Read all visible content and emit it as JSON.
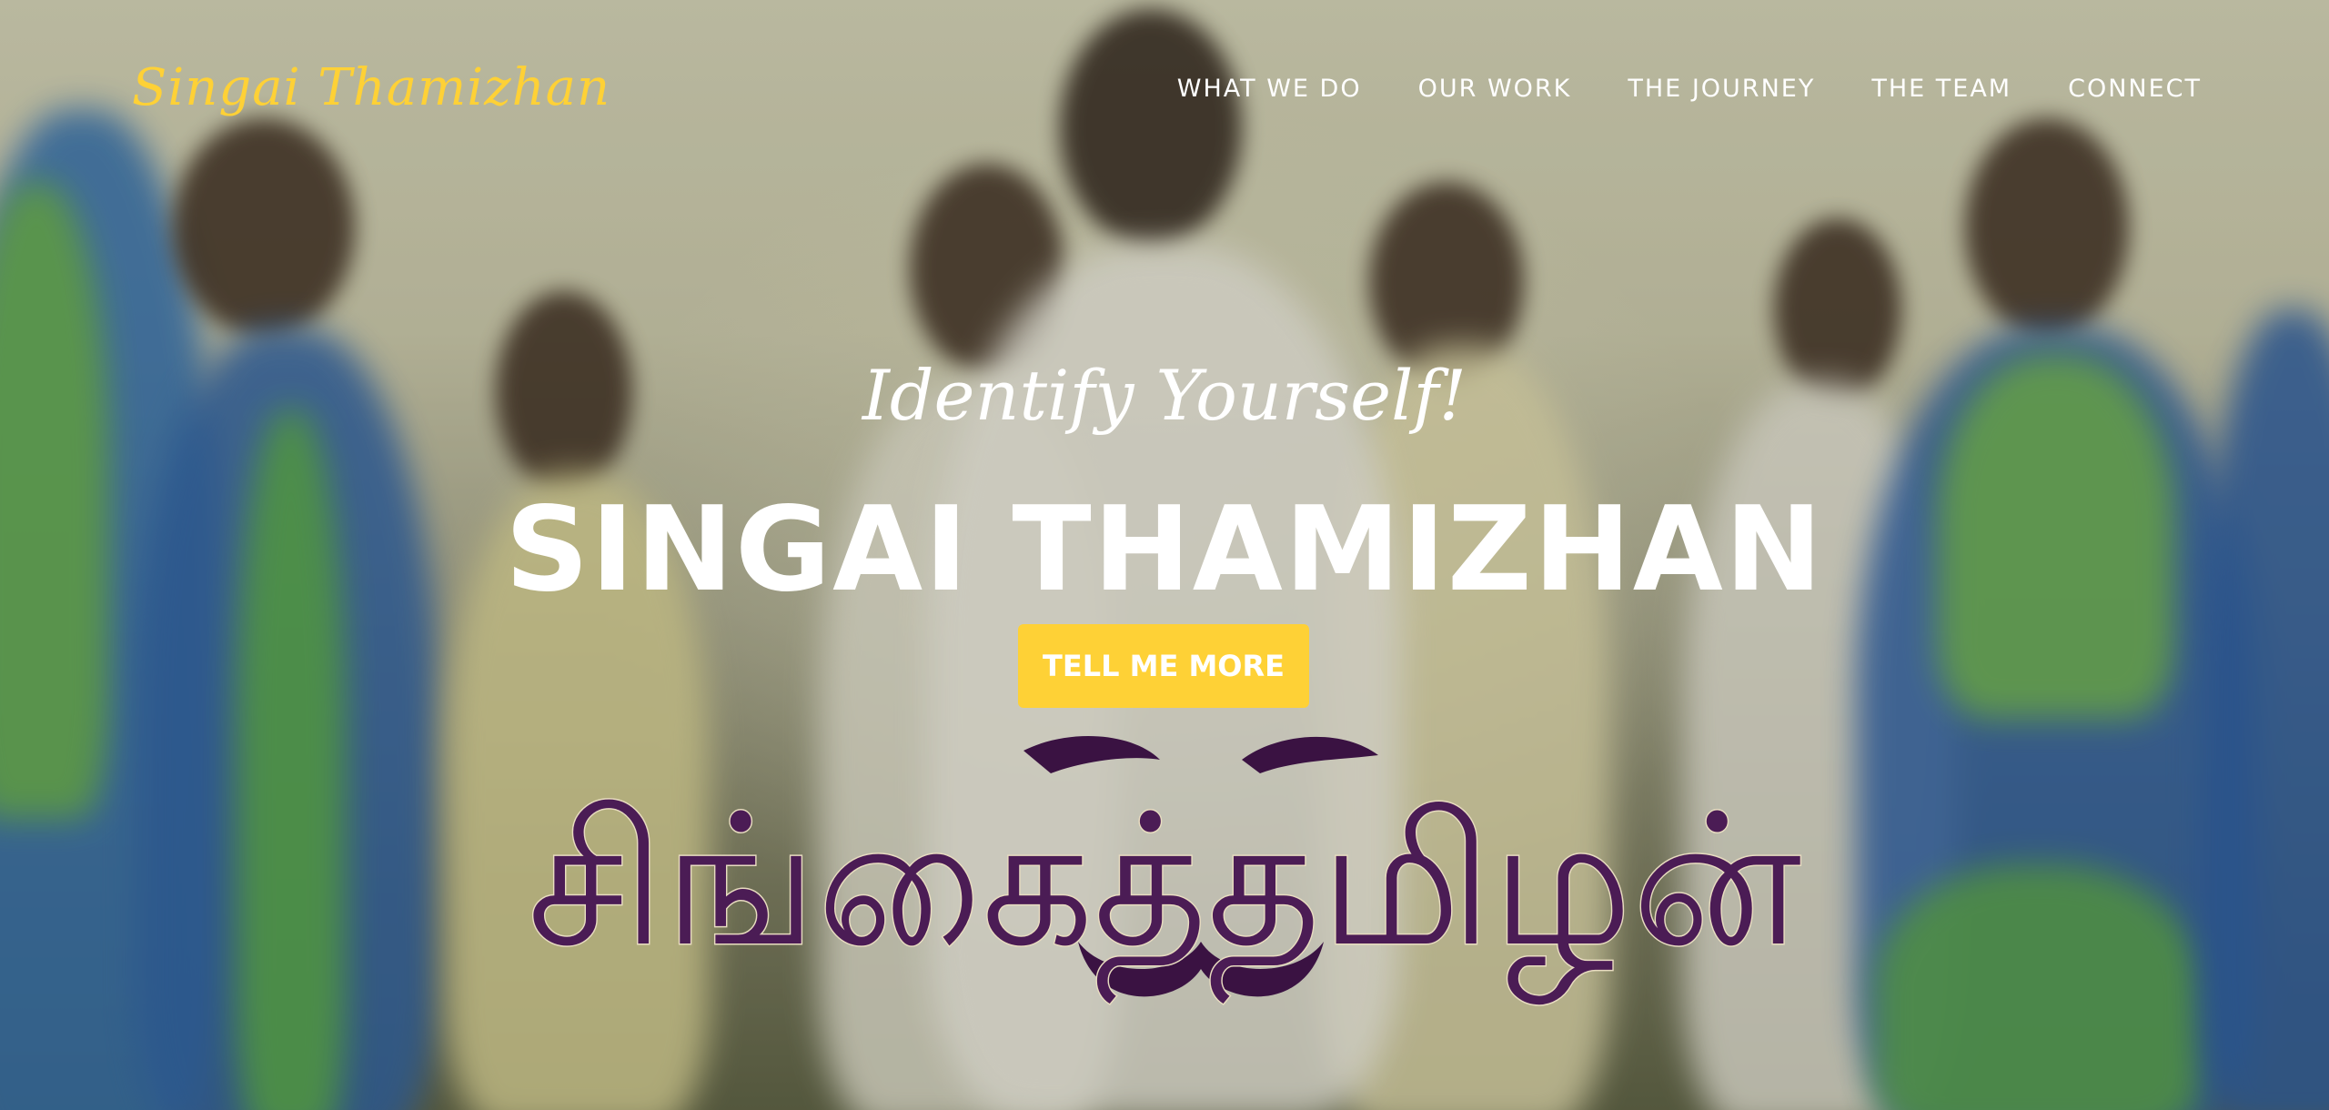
{
  "brand": {
    "name": "Singai Thamizhan"
  },
  "nav": {
    "items": [
      {
        "label": "WHAT WE DO"
      },
      {
        "label": "OUR WORK"
      },
      {
        "label": "THE JOURNEY"
      },
      {
        "label": "THE TEAM"
      },
      {
        "label": "CONNECT"
      }
    ]
  },
  "hero": {
    "lead": "Identify Yourself!",
    "heading": "SINGAI THAMIZHAN",
    "cta_label": "TELL ME MORE",
    "logo_text": "சிங்கைத்தமிழன்"
  },
  "colors": {
    "accent": "#fed136",
    "logo_purple": "#4b1c55",
    "text": "#ffffff"
  }
}
